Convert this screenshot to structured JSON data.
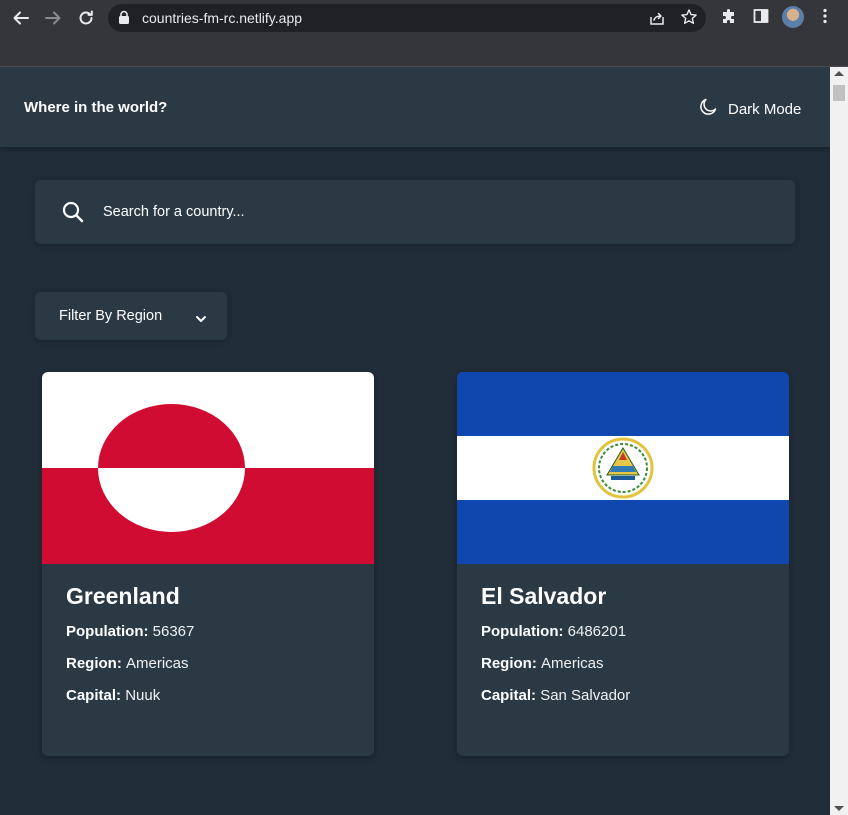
{
  "browser": {
    "url": "countries-fm-rc.netlify.app"
  },
  "header": {
    "title": "Where in the world?",
    "mode_label": "Dark Mode"
  },
  "search": {
    "placeholder": "Search for a country..."
  },
  "filter": {
    "label": "Filter By Region"
  },
  "labels": {
    "population": "Population:",
    "region": "Region:",
    "capital": "Capital:"
  },
  "countries": [
    {
      "name": "Greenland",
      "population": "56367",
      "region": "Americas",
      "capital": "Nuuk"
    },
    {
      "name": "El Salvador",
      "population": "6486201",
      "region": "Americas",
      "capital": "San Salvador"
    }
  ],
  "colors": {
    "page_bg": "#202c37",
    "element_bg": "#2b3945",
    "text": "#ffffff"
  },
  "icons": [
    "back-icon",
    "forward-icon",
    "reload-icon",
    "lock-icon",
    "share-icon",
    "star-icon",
    "extensions-icon",
    "side-panel-icon",
    "profile-avatar",
    "menu-icon",
    "moon-icon",
    "search-icon",
    "chevron-down-icon"
  ]
}
